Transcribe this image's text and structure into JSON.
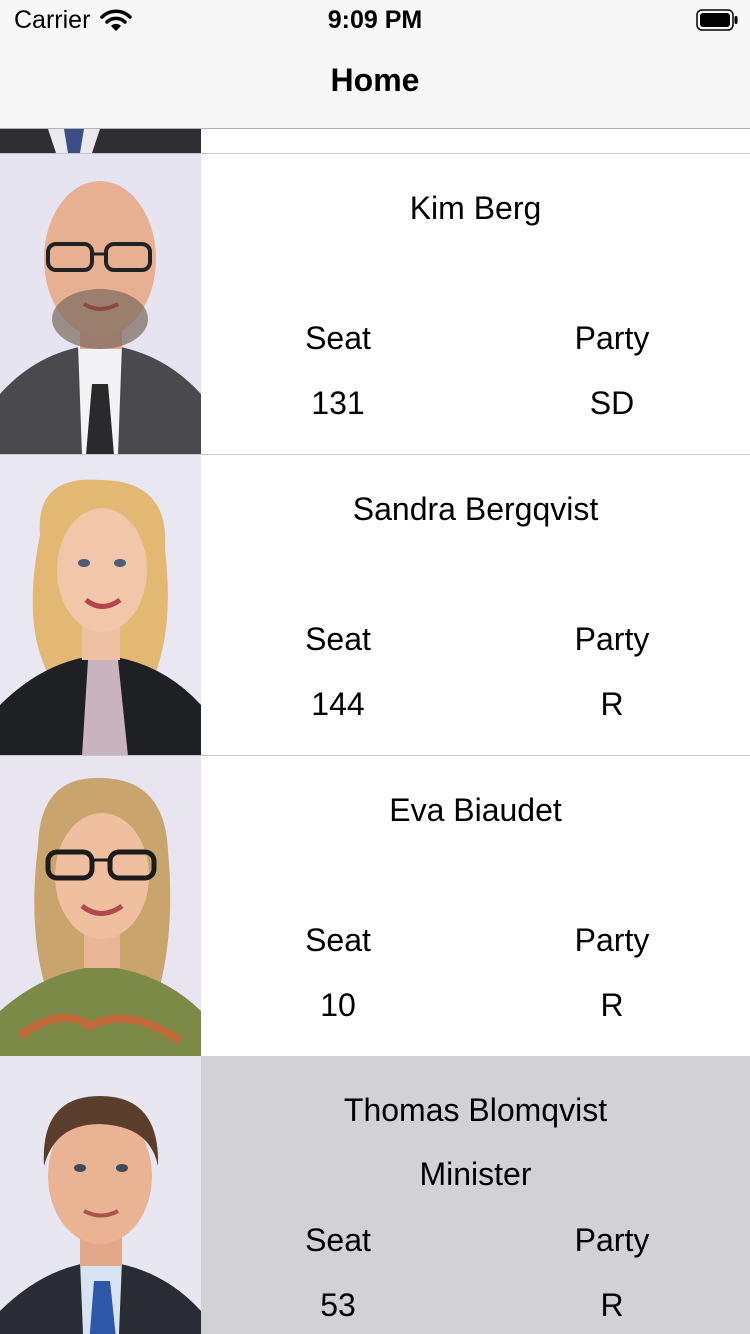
{
  "status_bar": {
    "carrier": "Carrier",
    "time": "9:09 PM"
  },
  "nav": {
    "title": "Home"
  },
  "labels": {
    "seat": "Seat",
    "party": "Party"
  },
  "members": [
    {
      "name": "Kim Berg",
      "role": "",
      "seat": "131",
      "party": "SD",
      "selected": false,
      "photo": "man-bald-glasses-portrait"
    },
    {
      "name": "Sandra Bergqvist",
      "role": "",
      "seat": "144",
      "party": "R",
      "selected": false,
      "photo": "woman-blonde-portrait"
    },
    {
      "name": "Eva Biaudet",
      "role": "",
      "seat": "10",
      "party": "R",
      "selected": false,
      "photo": "woman-glasses-portrait"
    },
    {
      "name": "Thomas Blomqvist",
      "role": "Minister",
      "seat": "53",
      "party": "R",
      "selected": true,
      "photo": "man-brown-hair-portrait"
    }
  ],
  "colors": {
    "selected_row": "#d1d1d6",
    "separator": "#c6c6c8",
    "bar": "#f7f7f7"
  }
}
